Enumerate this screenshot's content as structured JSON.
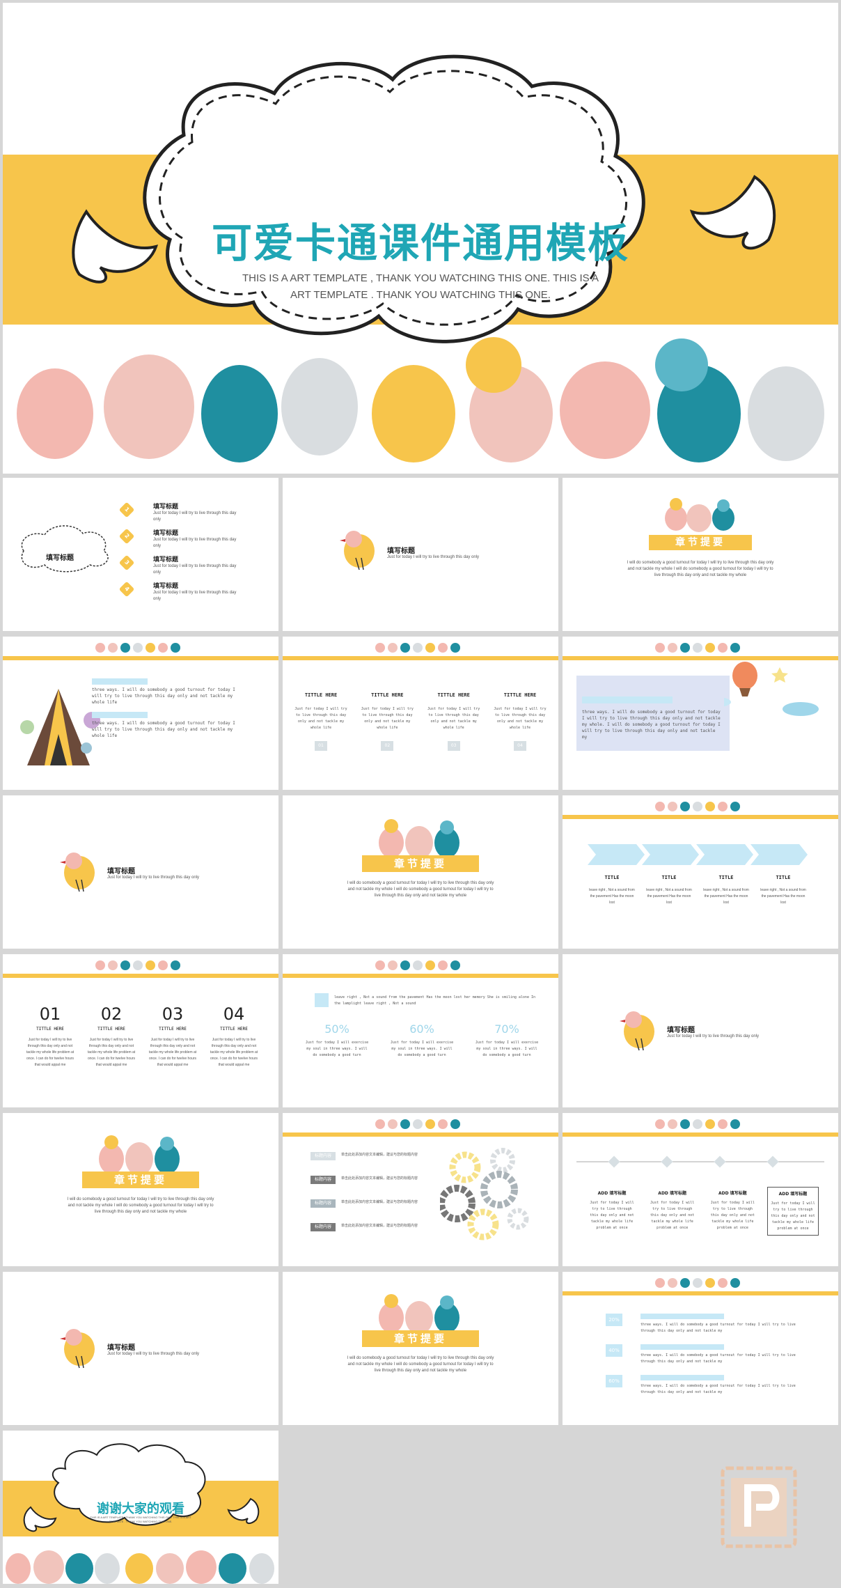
{
  "cover": {
    "title": "可爱卡通课件通用模板",
    "subtitle_line1": "THIS IS A ART  TEMPLATE , THANK YOU WATCHING THIS ONE. THIS IS A",
    "subtitle_line2": "ART TEMPLATE . THANK YOU WATCHING THIS ONE."
  },
  "toc": {
    "cloud_label": "填写标题",
    "items": [
      {
        "num": "1",
        "title": "填写标题",
        "desc": "Just for today I will try to live through this day only"
      },
      {
        "num": "2",
        "title": "填写标题",
        "desc": "Just for today I will try to live through this day only"
      },
      {
        "num": "3",
        "title": "填写标题",
        "desc": "Just for today I will try to live through this day only"
      },
      {
        "num": "4",
        "title": "填写标题",
        "desc": "Just for today I will try to live through this day only"
      }
    ]
  },
  "section_bird": {
    "title": "填写标题",
    "desc": "Just for today I will try to live through this day only"
  },
  "chapter": {
    "banner": "章节提要",
    "text1": "I will do somebody a good turnout for today I will try to live through this day only",
    "text2": "and not tackle my whole I will do somebody a good turnout for today I will try to",
    "text3": "live through this day only and not tackle my whole"
  },
  "slide4": {
    "para1": "three ways. I will do somebody a good turnout for today I will try to live through this day only and not tackle my whole life",
    "para2": "three ways. I will do somebody a good turnout for today I will try to live through this day only and not tackle my whole life"
  },
  "slide5": {
    "cols": [
      {
        "head": "TITTLE HERE",
        "text": "Just for today I will try to live through this day only and not tackle my whole life",
        "num": "01"
      },
      {
        "head": "TITTLE HERE",
        "text": "Just for today I will try to live through this day only and not tackle my whole life",
        "num": "02"
      },
      {
        "head": "TITTLE HERE",
        "text": "Just for today I will try to live through this day only and not tackle my whole life",
        "num": "03"
      },
      {
        "head": "TITTLE HERE",
        "text": "Just for today I will try to live through this day only and not tackle my whole life",
        "num": "04"
      }
    ]
  },
  "slide6": {
    "text": "three ways. I will do somebody a good turnout for today I will try to live through this day only and not tackle my whole. I will do somebody a good turnout for today I will try to live through this day only and not tackle my"
  },
  "slide9": {
    "items": [
      {
        "head": "TITLE",
        "text": "leave right , Not a sound from the pavement Has the moon lost"
      },
      {
        "head": "TITLE",
        "text": "leave right , Not a sound from the pavement Has the moon lost"
      },
      {
        "head": "TITLE",
        "text": "leave right , Not a sound from the pavement Has the moon lost"
      },
      {
        "head": "TITLE",
        "text": "leave right , Not a sound from the pavement Has the moon lost"
      }
    ]
  },
  "slide10": {
    "cols": [
      {
        "num": "01",
        "head": "TITTLE HERE",
        "text": "Just for today I will try to live through this day only and not tackle my whole life problem at once. I can do for twelve hours that would appal me"
      },
      {
        "num": "02",
        "head": "TITTLE HERE",
        "text": "Just for today I will try to live through this day only and not tackle my whole life problem at once. I can do for twelve hours that would appal me"
      },
      {
        "num": "03",
        "head": "TITTLE HERE",
        "text": "Just for today I will try to live through this day only and not tackle my whole life problem at once. I can do for twelve hours that would appal me"
      },
      {
        "num": "04",
        "head": "TITTLE HERE",
        "text": "Just for today I will try to live through this day only and not tackle my whole life problem at once. I can do for twelve hours that would appal me"
      }
    ]
  },
  "slide11": {
    "top": "leave right , Not a sound from the pavement Has the moon lost her memory She is smiling alone In the lamplight leave right , Not a sound",
    "stats": [
      {
        "pct": "50%",
        "text": "Just for today I will exercise my soul in three ways. I will do somebody a good turn"
      },
      {
        "pct": "60%",
        "text": "Just for today I will exercise my soul in three ways. I will do somebody a good turn"
      },
      {
        "pct": "70%",
        "text": "Just for today I will exercise my soul in three ways. I will do somebody a good turn"
      }
    ]
  },
  "slide14": {
    "rows": [
      {
        "tag": "标题内容",
        "text": "单击此处添加内容文本编辑，建议与您的标题内容"
      },
      {
        "tag": "标题内容",
        "text": "单击此处添加内容文本编辑，建议与您的标题内容"
      },
      {
        "tag": "标题内容",
        "text": "单击此处添加内容文本编辑，建议与您的标题内容"
      },
      {
        "tag": "标题内容",
        "text": "单击此处添加内容文本编辑，建议与您的标题内容"
      }
    ]
  },
  "slide15": {
    "cols": [
      {
        "head": "ADD 填写标题",
        "text": "Just for today I will try to live through this day only and not tackle my whole life problem at once"
      },
      {
        "head": "ADD 填写标题",
        "text": "Just for today I will try to live through this day only and not tackle my whole life problem at once"
      },
      {
        "head": "ADD 填写标题",
        "text": "Just for today I will try to live through this day only and not tackle my whole life problem at once"
      },
      {
        "head": "ADD 填写标题",
        "text": "Just for today I will try to live through this day only and not tackle my whole life problem at once"
      }
    ]
  },
  "slide18": {
    "rows": [
      {
        "pct": "20%",
        "text": "three ways. I will do somebody a good turnout for today I will try to live through this day only and not tackle my"
      },
      {
        "pct": "40%",
        "text": "three ways. I will do somebody a good turnout for today I will try to live through this day only and not tackle my"
      },
      {
        "pct": "60%",
        "text": "three ways. I will do somebody a good turnout for today I will try to live through this day only and not tackle my"
      }
    ]
  },
  "ending": {
    "title": "谢谢大家的观看",
    "sub": "THIS IS A ART TEMPLATE , THANK YOU WATCHING THIS ONE. THIS IS A ART TEMPLATE . THANK YOU WATCHING THIS ONE."
  },
  "colors": {
    "yellow": "#f7c54b",
    "teal": "#1fa6b5",
    "pink": "#f3b8b0",
    "blue": "#c6e8f6"
  }
}
